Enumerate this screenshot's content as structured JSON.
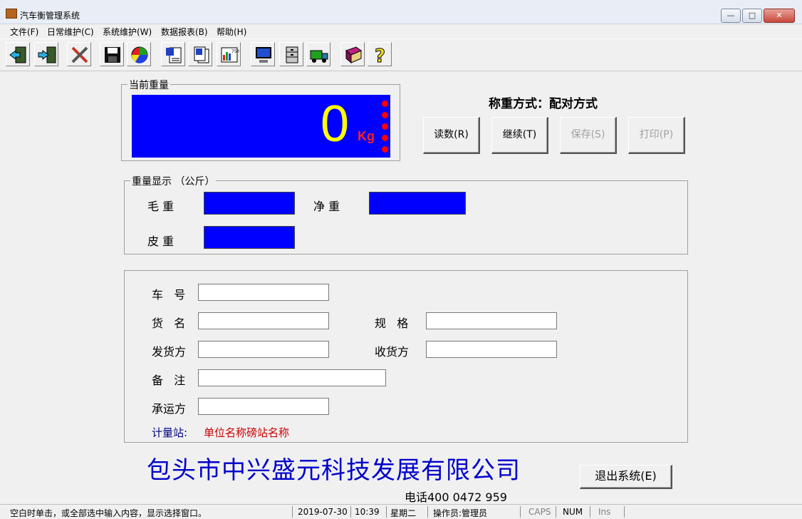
{
  "window": {
    "title": "汽车衡管理系统",
    "controls": [
      "—",
      "□",
      "✕"
    ]
  },
  "menu": [
    "文件(F)",
    "日常维护(C)",
    "系统维护(W)",
    "数据报表(B)",
    "帮助(H)"
  ],
  "toolbar_icons": [
    "exit-door-icon",
    "login-door-icon",
    "tools-icon",
    "save-icon",
    "pie-chart-icon",
    "document-icon",
    "document-copy-icon",
    "report-chart-icon",
    "computer-icon",
    "cabinet-icon",
    "truck-icon",
    "help-book-icon",
    "question-mark-icon"
  ],
  "current_weight": {
    "label": "当前重量",
    "value": "0",
    "unit": "Kg"
  },
  "weigh_mode": "称重方式：配对方式",
  "buttons": {
    "read": "读数(R)",
    "continue": "继续(T)",
    "save": "保存(S)",
    "print": "打印(P)",
    "exit": "退出系统(E)"
  },
  "weight_display": {
    "label": "重量显示 （公斤）",
    "gross": "毛 重",
    "net": "净 重",
    "tare": "皮 重"
  },
  "form": {
    "plate": "车   号",
    "goods": "货   名",
    "spec": "规   格",
    "shipper": "发货方",
    "receiver": "收货方",
    "remark": "备   注",
    "carrier": "承运方",
    "station_label": "计量站:",
    "station_value": "单位名称磅站名称"
  },
  "company": "包头市中兴盛元科技发展有限公司",
  "phone": "电话400 0472 959",
  "status": {
    "hint": "空白时单击，或全部选中输入内容，显示选择窗口。",
    "date": "2019-07-30",
    "time": "10:39",
    "weekday": "星期二",
    "operator": "操作员:管理员",
    "caps": "CAPS",
    "num": "NUM",
    "ins": "Ins"
  },
  "colors": {
    "display_bg": "#0000ff",
    "digit": "#ffff00",
    "unit": "#ff0000",
    "company": "#0000cc",
    "station": "#cc0000"
  }
}
